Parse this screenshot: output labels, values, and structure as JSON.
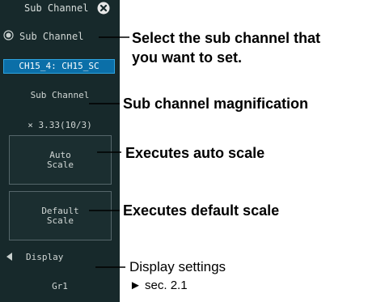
{
  "panel": {
    "title": "Sub Channel",
    "sub_channel_label": "Sub Channel",
    "selected_channel": "CH15_4: CH15_SC",
    "magnification_label": "Sub Channel",
    "magnification_value": "× 3.33(10/3)",
    "auto_scale_label": "Auto\nScale",
    "default_scale_label": "Default\nScale",
    "display_label": "Display",
    "display_value": "Gr1",
    "colors": {
      "panel_bg": "#17292b",
      "selected_bg": "#0b6fa8",
      "text": "#d0d6d4"
    },
    "icons": {
      "close": "close-circle-icon",
      "radio": "radio-selected-icon",
      "display_arrow": "triangle-left-icon"
    }
  },
  "annotations": {
    "sub_channel_line1": "Select the sub channel that",
    "sub_channel_line2": "you want to set.",
    "magnification": "Sub channel magnification",
    "auto_scale": "Executes auto scale",
    "default_scale": "Executes default scale",
    "display_line1": "Display settings",
    "display_line2": "► sec. 2.1"
  }
}
